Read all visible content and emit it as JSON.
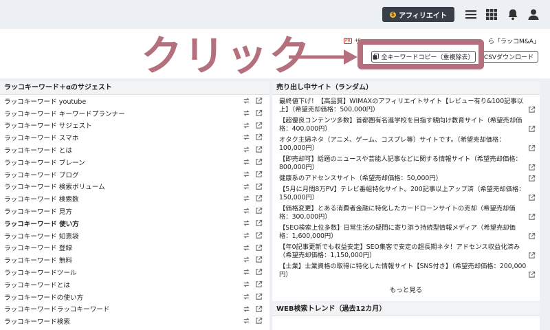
{
  "topbar": {
    "affiliate_label": "アフィリエイト"
  },
  "notice": {
    "badge": "PR",
    "text": "ザ",
    "right_text": "ら「ラッコM&A」"
  },
  "actions": {
    "copy_label": "全キーワードコピー（重複除去）",
    "csv_label": "CSVダウンロード"
  },
  "annotation": {
    "label": "クリック"
  },
  "suggest": {
    "header": "ラッコキーワード＋αのサジェスト",
    "items": [
      {
        "text": "ラッコキーワード youtube",
        "bold": false
      },
      {
        "text": "ラッコキーワード キーワードプランナー",
        "bold": false
      },
      {
        "text": "ラッコキーワード サジェスト",
        "bold": false
      },
      {
        "text": "ラッコキーワード スマホ",
        "bold": false
      },
      {
        "text": "ラッコキーワード とは",
        "bold": false
      },
      {
        "text": "ラッコキーワード ブレーン",
        "bold": false
      },
      {
        "text": "ラッコキーワード ブログ",
        "bold": false
      },
      {
        "text": "ラッコキーワード 検索ボリューム",
        "bold": false
      },
      {
        "text": "ラッコキーワード 検索数",
        "bold": false
      },
      {
        "text": "ラッコキーワード 見方",
        "bold": false
      },
      {
        "text": "ラッコキーワード 使い方",
        "bold": true
      },
      {
        "text": "ラッコキーワード 知恵袋",
        "bold": false
      },
      {
        "text": "ラッコキーワード 登録",
        "bold": false
      },
      {
        "text": "ラッコキーワード 無料",
        "bold": false
      },
      {
        "text": "ラッコキーワードツール",
        "bold": false
      },
      {
        "text": "ラッコキーワードとは",
        "bold": false
      },
      {
        "text": "ラッコキーワードの使い方",
        "bold": false
      },
      {
        "text": "ラッコキーワードラッコキーワード",
        "bold": false
      },
      {
        "text": "ラッコキーワード検索",
        "bold": false
      }
    ]
  },
  "sale": {
    "header": "売り出し中サイト（ランダム）",
    "items": [
      "最終値下げ！【高品質】WIMAXのアフィリエイトサイト【レビュー有り&100記事以上】（希望売却価格：500,000円）",
      "【超優良コンテンツ多数】首都圏有名進学校を目指す親向け教育サイト（希望売却価格：400,000円）",
      "オタク主婦ネタ（アニメ、ゲーム、コスプレ等）サイトです。（希望売却価格：100,000円）",
      "【即売却可】話題のニュースや芸能人記事などに関する情報サイト（希望売却価格：800,000円）",
      "健康系のアドセンスサイト（希望売却価格：50,000円）",
      "【5月に月間8万PV】テレビ番組特化サイト。200記事以上アップ済（希望売却価格：150,000円）",
      "【価格変更】とある消費者金融に特化したカードローンサイトの売却（希望売却価格：300,000円）",
      "【SEO検索上位多数】日常生活の疑問に寄り添う持続型情報メディア（希望売却価格：1,600,000円）",
      "【年0記事更新でも収益安定】SEO集客で安定の超長期ネタ！アドセンス収益化済み（希望売却価格：1,150,000円）",
      "【士業】士業資格の取得に特化した情報サイト【SNS付き】（希望売却価格：200,000円）"
    ],
    "more_label": "もっと見る"
  },
  "trend": {
    "header": "WEB検索トレンド（過去12カ月）"
  }
}
